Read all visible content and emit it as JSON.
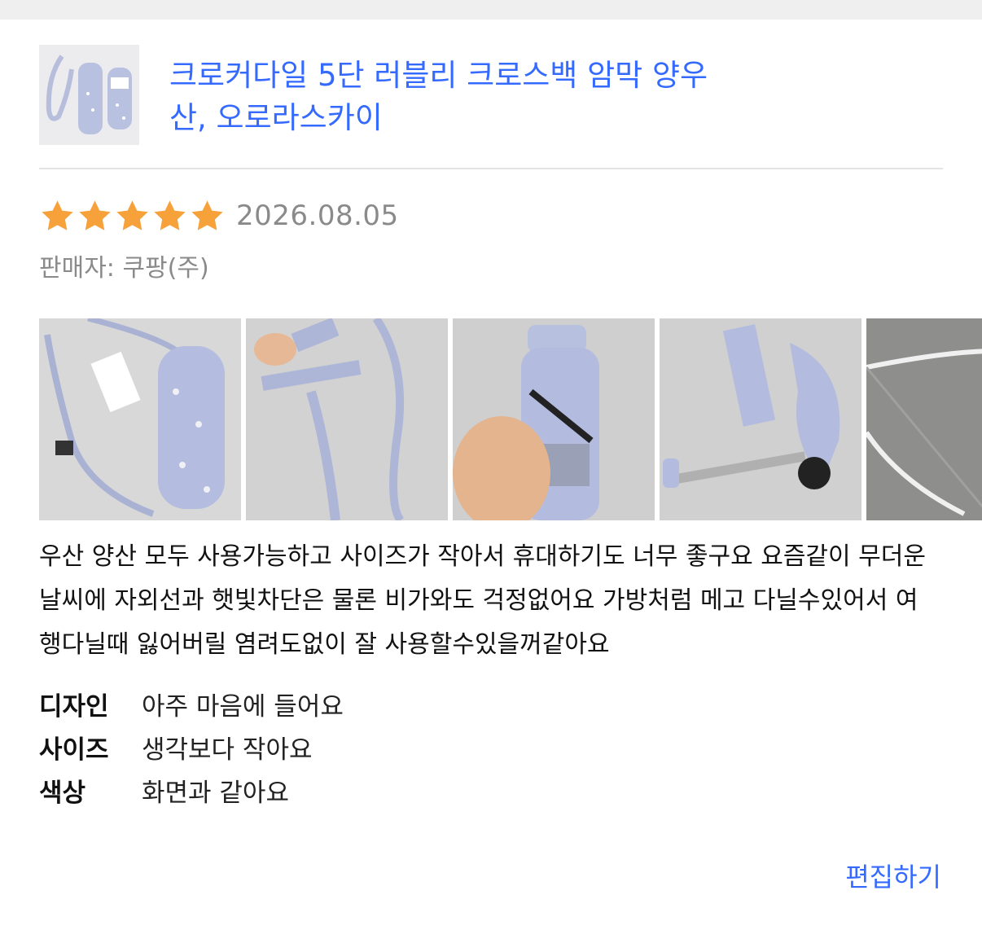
{
  "product": {
    "title": "크로커다일 5단 러블리 크로스백 암막 양우산, 오로라스카이",
    "thumbnail_icon": "umbrella-product-image"
  },
  "review": {
    "rating": 5,
    "rating_max": 5,
    "star_color": "#f7a13b",
    "date": "2026.08.05",
    "seller": "판매자: 쿠팡(주)",
    "photos": [
      {
        "icon": "umbrella-with-strap-photo"
      },
      {
        "icon": "umbrella-strap-photo"
      },
      {
        "icon": "umbrella-in-hand-photo"
      },
      {
        "icon": "folded-umbrella-photo"
      },
      {
        "icon": "open-umbrella-inside-photo"
      }
    ],
    "text": "우산 양산 모두 사용가능하고 사이즈가 작아서 휴대하기도 너무 좋구요 요즘같이 무더운 날씨에 자외선과 햇빛차단은 물론 비가와도 걱정없어요 가방처럼 메고 다닐수있어서 여행다닐때 잃어버릴 염려도없이 잘 사용할수있을꺼같아요",
    "attributes": [
      {
        "key": "디자인",
        "value": "아주 마음에 들어요"
      },
      {
        "key": "사이즈",
        "value": "생각보다 작아요"
      },
      {
        "key": "색상",
        "value": "화면과 같아요"
      }
    ],
    "edit_label": "편집하기"
  },
  "colors": {
    "link": "#346aff",
    "muted": "#8a8a8a",
    "umbrella": "#aeb6d8"
  }
}
